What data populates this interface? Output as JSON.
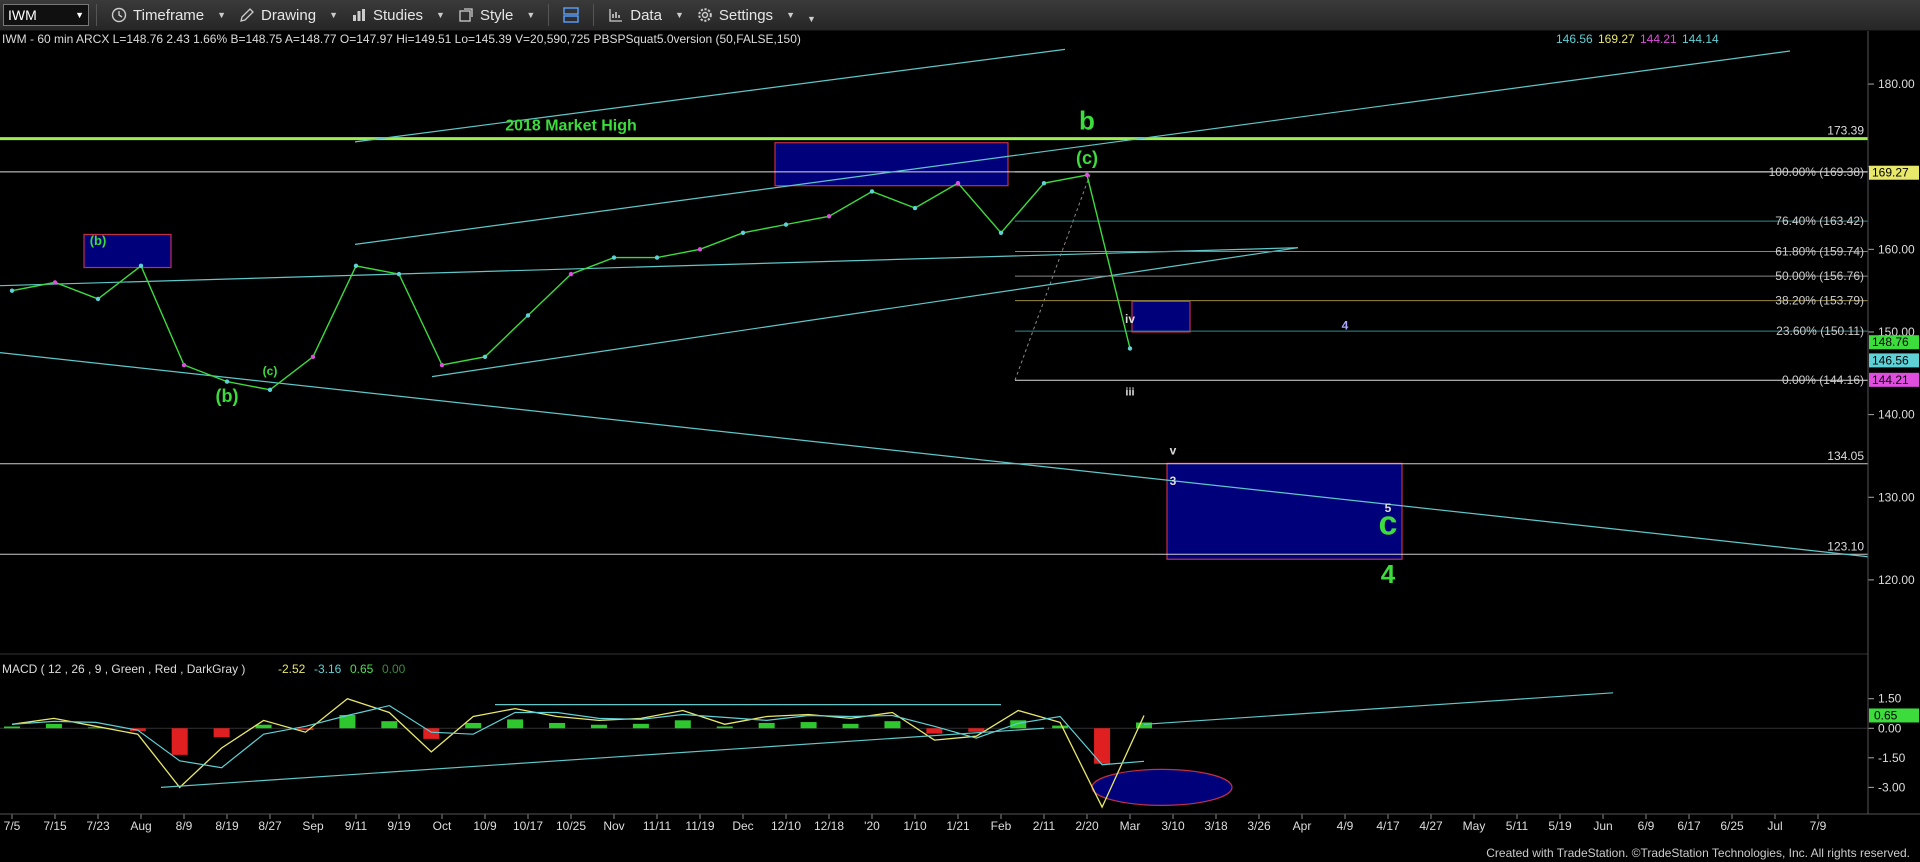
{
  "toolbar": {
    "symbol": "IWM",
    "items": [
      {
        "key": "timeframe",
        "label": "Timeframe",
        "icon": "clock-icon"
      },
      {
        "key": "drawing",
        "label": "Drawing",
        "icon": "pencil-icon"
      },
      {
        "key": "studies",
        "label": "Studies",
        "icon": "studies-icon"
      },
      {
        "key": "style",
        "label": "Style",
        "icon": "style-icon"
      },
      {
        "key": "layout",
        "label": "",
        "icon": "layout-icon"
      },
      {
        "key": "data",
        "label": "Data",
        "icon": "data-icon"
      },
      {
        "key": "settings",
        "label": "Settings",
        "icon": "gear-icon"
      }
    ]
  },
  "header": {
    "info": "IWM - 60 min  ARCX  L=148.76  2.43  1.66%  B=148.75  A=148.77  O=147.97  Hi=149.51  Lo=145.39  V=20,590,725  PBSPSquat5.0version (50,FALSE,150)",
    "extras": [
      {
        "text": "146.56",
        "color": "#5fd1d6"
      },
      {
        "text": "169.27",
        "color": "#e8e86a"
      },
      {
        "text": "144.21",
        "color": "#e04ee0"
      },
      {
        "text": "144.14",
        "color": "#5fd1d6"
      }
    ]
  },
  "macd_header": {
    "label": "MACD ( 12 , 26 , 9 , Green , Red , DarkGray )",
    "values": [
      {
        "text": "-2.52",
        "color": "#e8e86a"
      },
      {
        "text": "-3.16",
        "color": "#5fd1d6"
      },
      {
        "text": "0.65",
        "color": "#4ee04e"
      },
      {
        "text": "0.00",
        "color": "#3c8a3c"
      }
    ]
  },
  "footer": "Created with TradeStation. ©TradeStation Technologies, Inc. All rights reserved.",
  "colors": {
    "trendline": "#5fc7c9",
    "box_fill": "#00007a",
    "box_border": "#c0304a",
    "wave_green": "#3cdc3c",
    "market_high": "#9cf04c",
    "fib_label": "#cccccc"
  },
  "chart_data": {
    "type": "line",
    "x": [
      "7/5",
      "7/15",
      "7/23",
      "Aug",
      "8/9",
      "8/19",
      "8/27",
      "Sep",
      "9/11",
      "9/19",
      "Oct",
      "10/9",
      "10/17",
      "10/25",
      "Nov",
      "11/11",
      "11/19",
      "Dec",
      "12/10",
      "12/18",
      "'20",
      "1/10",
      "1/21",
      "Feb",
      "2/11",
      "2/20",
      "Mar",
      "3/10",
      "3/18",
      "3/26",
      "Apr",
      "4/9",
      "4/17",
      "4/27",
      "May",
      "5/11",
      "5/19",
      "Jun",
      "6/9",
      "6/17",
      "6/25",
      "Jul",
      "7/9"
    ],
    "price_series": {
      "name": "IWM",
      "values": [
        155,
        156,
        154,
        158,
        146,
        144,
        143,
        147,
        158,
        157,
        146,
        147,
        152,
        157,
        159,
        159,
        160,
        162,
        163,
        164,
        167,
        165,
        168,
        162,
        168,
        169,
        148
      ]
    },
    "price_axis": {
      "ylim": [
        112,
        184
      ],
      "ticks": [
        180,
        170,
        160,
        150,
        140,
        130,
        120
      ],
      "tick_labels": [
        "180.00",
        "",
        "160.00",
        "150.00",
        "140.00",
        "130.00",
        "120.00"
      ]
    },
    "price_markers": [
      {
        "text": "169.27",
        "value": 169.27,
        "bg": "#e8e86a",
        "fg": "#000"
      },
      {
        "text": "148.76",
        "value": 148.76,
        "bg": "#3cdc3c",
        "fg": "#000"
      },
      {
        "text": "146.56",
        "value": 146.56,
        "bg": "#5fd1d6",
        "fg": "#000"
      },
      {
        "text": "144.21",
        "value": 144.21,
        "bg": "#e04ee0",
        "fg": "#000"
      }
    ],
    "levels": [
      {
        "label": "173.39",
        "value": 173.39,
        "color": "#9cf04c"
      },
      {
        "label": "134.05",
        "value": 134.05,
        "color": "#cccccc"
      },
      {
        "label": "123.10",
        "value": 123.1,
        "color": "#cccccc"
      }
    ],
    "fib_levels": [
      {
        "label": "100.00% (169.38)",
        "value": 169.38,
        "color": "#dddddd"
      },
      {
        "label": "76.40% (163.42)",
        "value": 163.42,
        "color": "#2f8c8c"
      },
      {
        "label": "61.80% (159.74)",
        "value": 159.74,
        "color": "#9a8a3a"
      },
      {
        "label": "50.00% (156.76)",
        "value": 156.76,
        "color": "#888888"
      },
      {
        "label": "38.20% (153.79)",
        "value": 153.79,
        "color": "#9a8a3a"
      },
      {
        "label": "23.60% (150.11)",
        "value": 150.11,
        "color": "#2f8c8c"
      },
      {
        "label": "0.00% (144.16)",
        "value": 144.16,
        "color": "#dddddd"
      }
    ],
    "annotations": [
      {
        "text": "2018 Market High",
        "x": "10/25",
        "y": 174.4,
        "color": "#3cdc3c",
        "size": 16
      },
      {
        "text": "b",
        "x": "2/20",
        "y": 174.5,
        "color": "#3cdc3c",
        "size": 26
      },
      {
        "text": "(c)",
        "x": "2/20",
        "y": 170.3,
        "color": "#3cdc3c",
        "size": 18
      },
      {
        "text": "(b)",
        "x": "7/23",
        "y": 160.5,
        "color": "#3cdc3c",
        "size": 13
      },
      {
        "text": "(c)",
        "x": "8/27",
        "y": 144.8,
        "color": "#3cdc3c",
        "size": 12
      },
      {
        "text": "(b)",
        "x": "8/19",
        "y": 141.5,
        "color": "#3cdc3c",
        "size": 18
      },
      {
        "text": "iv",
        "x": "Mar",
        "y": 151.1,
        "color": "#dddddd",
        "size": 12
      },
      {
        "text": "iii",
        "x": "Mar",
        "y": 142.3,
        "color": "#dddddd",
        "size": 11
      },
      {
        "text": "4",
        "x": "4/9",
        "y": 150.3,
        "color": "#aaaaff",
        "size": 12
      },
      {
        "text": "v",
        "x": "3/10",
        "y": 135.2,
        "color": "#dddddd",
        "size": 12
      },
      {
        "text": "3",
        "x": "3/10",
        "y": 131.5,
        "color": "#dddddd",
        "size": 12
      },
      {
        "text": "5",
        "x": "4/17",
        "y": 128.2,
        "color": "#dddddd",
        "size": 12
      },
      {
        "text": "c",
        "x": "4/17",
        "y": 125.5,
        "color": "#3cdc3c",
        "size": 34
      },
      {
        "text": "4",
        "x": "4/17",
        "y": 119.6,
        "color": "#3cdc3c",
        "size": 26
      }
    ],
    "macd": {
      "name": "MACD",
      "values": [
        0.2,
        0.5,
        0.1,
        -0.3,
        -3.0,
        -1.0,
        0.4,
        -0.2,
        1.5,
        0.8,
        -1.2,
        0.6,
        1.0,
        0.6,
        0.4,
        0.5,
        0.9,
        0.2,
        0.6,
        0.7,
        0.5,
        0.8,
        -0.6,
        -0.4,
        0.9,
        0.3,
        -4.0,
        0.65
      ],
      "ylim": [
        -4.2,
        2.4
      ],
      "ticks": [
        1.5,
        0,
        -1.5,
        -3
      ],
      "tick_labels": [
        "1.50",
        "0.00",
        "-1.50",
        "-3.00"
      ],
      "marker": {
        "text": "0.65",
        "value": 0.65,
        "bg": "#3cdc3c",
        "fg": "#000"
      }
    }
  }
}
